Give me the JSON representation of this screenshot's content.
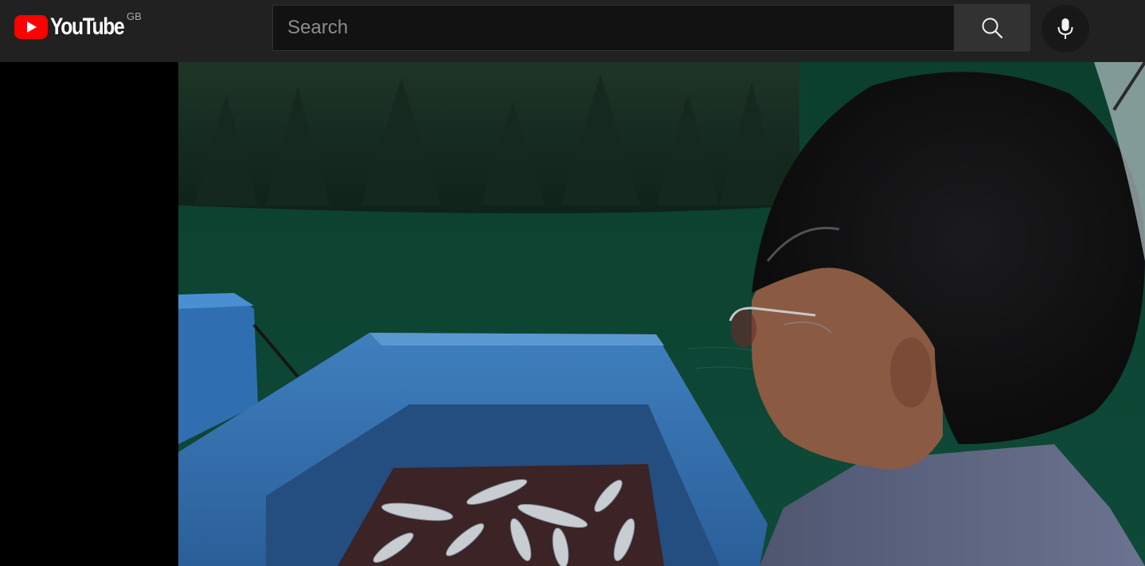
{
  "header": {
    "logo_text": "YouTube",
    "country_code": "GB",
    "search": {
      "placeholder": "Search",
      "value": ""
    },
    "search_button_icon": "search-icon",
    "mic_button_icon": "mic-icon"
  },
  "colors": {
    "topbar_bg": "#212121",
    "logo_red": "#ff0000",
    "page_bg": "#000000"
  },
  "player": {
    "video_content": "video-frame"
  }
}
